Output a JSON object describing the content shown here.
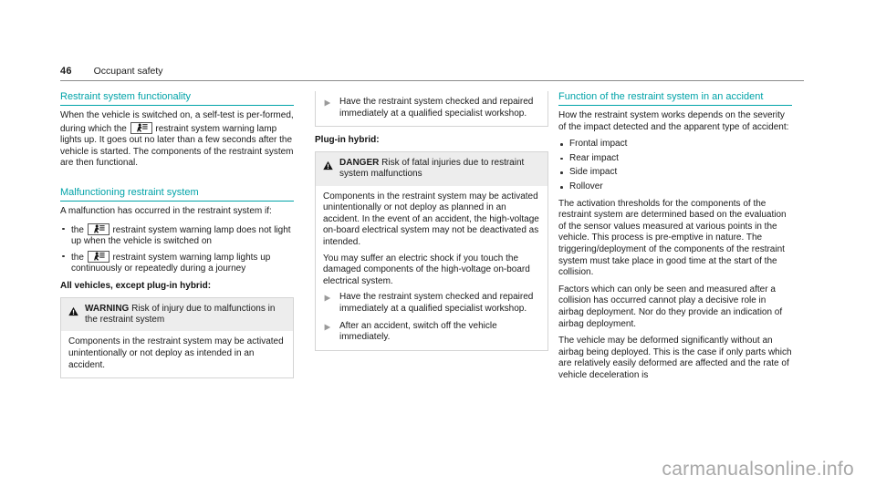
{
  "runhead": {
    "page_number": "46",
    "chapter": "Occupant safety"
  },
  "column1": {
    "heading1": "Restraint system functionality",
    "para1_a": "When the vehicle is switched on, a self-test is per-formed, during which the",
    "para1_b": "restraint system warning lamp lights up. It goes out no later than a few seconds after the vehicle is started. The components of the restraint system are then functional.",
    "heading2": "Malfunctioning restraint system",
    "para2": "A malfunction has occurred in the restraint system if:",
    "bullet1_a": "the",
    "bullet1_b": "restraint system warning lamp does not light up when the vehicle is switched on",
    "bullet2_a": "the",
    "bullet2_b": "restraint system warning lamp lights up continuously or repeatedly during a journey",
    "lead": "All vehicles, except plug-in hybrid:",
    "warning_box": {
      "label": "WARNING",
      "title": "Risk of injury due to malfunctions in the restraint system",
      "body1": "Components in the restraint system may be activated unintentionally or not deploy as intended in an accident."
    }
  },
  "column2": {
    "cropped_box": {
      "action1": "Have the restraint system checked and repaired immediately at a qualified specialist workshop."
    },
    "lead": "Plug-in hybrid:",
    "danger_box": {
      "label": "DANGER",
      "title": "Risk of fatal injuries due to restraint system malfunctions",
      "body1": "Components in the restraint system may be activated unintentionally or not deploy as planned in an accident. In the event of an accident, the high-voltage on-board electrical system may not be deactivated as intended.",
      "body2": "You may suffer an electric shock if you touch the damaged components of the high-voltage on-board electrical system.",
      "action1": "Have the restraint system checked and repaired immediately at a qualified specialist workshop.",
      "action2": "After an accident, switch off the vehicle immediately."
    }
  },
  "column3": {
    "heading1": "Function of the restraint system in an accident",
    "para1": "How the restraint system works depends on the severity of the impact detected and the apparent type of accident:",
    "bullets": [
      "Frontal impact",
      "Rear impact",
      "Side impact",
      "Rollover"
    ],
    "para2": "The activation thresholds for the components of the restraint system are determined based on the evaluation of the sensor values measured at various points in the vehicle. This process is pre-emptive in nature. The triggering/deployment of the components of the restraint system must take place in good time at the start of the collision.",
    "para3": "Factors which can only be seen and measured after a collision has occurred cannot play a decisive role in airbag deployment. Nor do they provide an indication of airbag deployment.",
    "para4": "The vehicle may be deformed significantly without an airbag being deployed. This is the case if only parts which are relatively easily deformed are affected and the rate of vehicle deceleration is"
  },
  "watermark": "carmanualsonline.info",
  "colors": {
    "heading_teal": "#00a3a8",
    "rule_gray": "#8c8c8c",
    "box_header_gray": "#ededed",
    "box_border": "#d4d4d4",
    "text": "#1a1a1a"
  },
  "icons": {
    "restraint_lamp": "restraint-system-warning-lamp-icon",
    "warning_triangle": "warning-triangle-icon",
    "action_arrow": "action-arrow-icon"
  }
}
